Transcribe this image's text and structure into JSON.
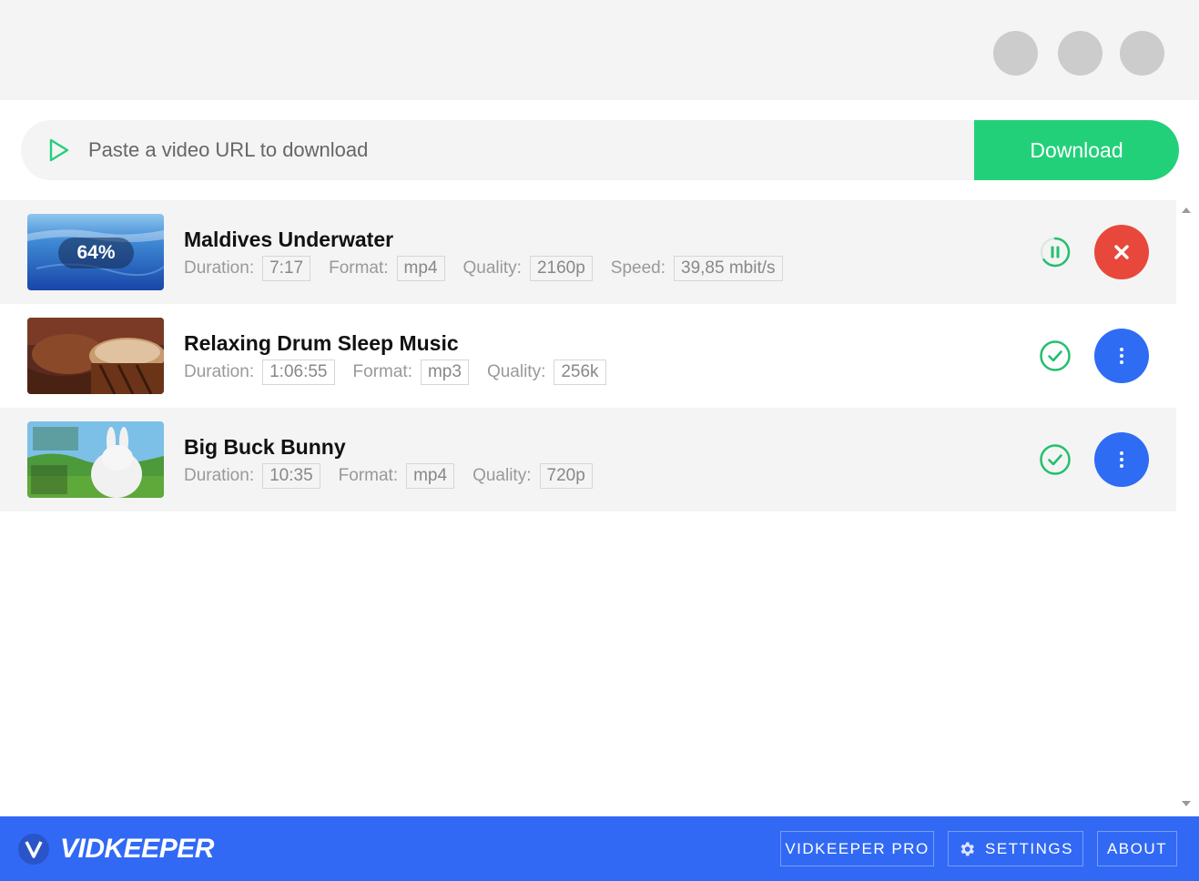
{
  "window": {
    "controls": [
      "window-button",
      "window-button",
      "window-button"
    ]
  },
  "url_bar": {
    "placeholder": "Paste a video URL to download",
    "value": "",
    "download_label": "Download"
  },
  "downloads": [
    {
      "title": "Maldives Underwater",
      "status": "downloading",
      "progress_label": "64%",
      "progress": 0.64,
      "fields": [
        {
          "label": "Duration:",
          "value": "7:17"
        },
        {
          "label": "Format:",
          "value": "mp4"
        },
        {
          "label": "Quality:",
          "value": "2160p"
        },
        {
          "label": "Speed:",
          "value": "39,85 mbit/s"
        }
      ],
      "status_icon": "pause-icon",
      "action_icon": "close-icon"
    },
    {
      "title": "Relaxing Drum Sleep Music",
      "status": "completed",
      "fields": [
        {
          "label": "Duration:",
          "value": "1:06:55"
        },
        {
          "label": "Format:",
          "value": "mp3"
        },
        {
          "label": "Quality:",
          "value": "256k"
        }
      ],
      "status_icon": "check-circle-icon",
      "action_icon": "more-vertical-icon"
    },
    {
      "title": "Big Buck Bunny",
      "status": "completed",
      "fields": [
        {
          "label": "Duration:",
          "value": "10:35"
        },
        {
          "label": "Format:",
          "value": "mp4"
        },
        {
          "label": "Quality:",
          "value": "720p"
        }
      ],
      "status_icon": "check-circle-icon",
      "action_icon": "more-vertical-icon"
    }
  ],
  "footer": {
    "logo_text": "VIDKEEPER",
    "pro_label": "VIDKEEPER PRO",
    "settings_label": "SETTINGS",
    "about_label": "ABOUT"
  },
  "colors": {
    "accent_green": "#23d07a",
    "cancel_red": "#e8483b",
    "menu_blue": "#2e6cf4",
    "footer_blue": "#3169f5"
  }
}
